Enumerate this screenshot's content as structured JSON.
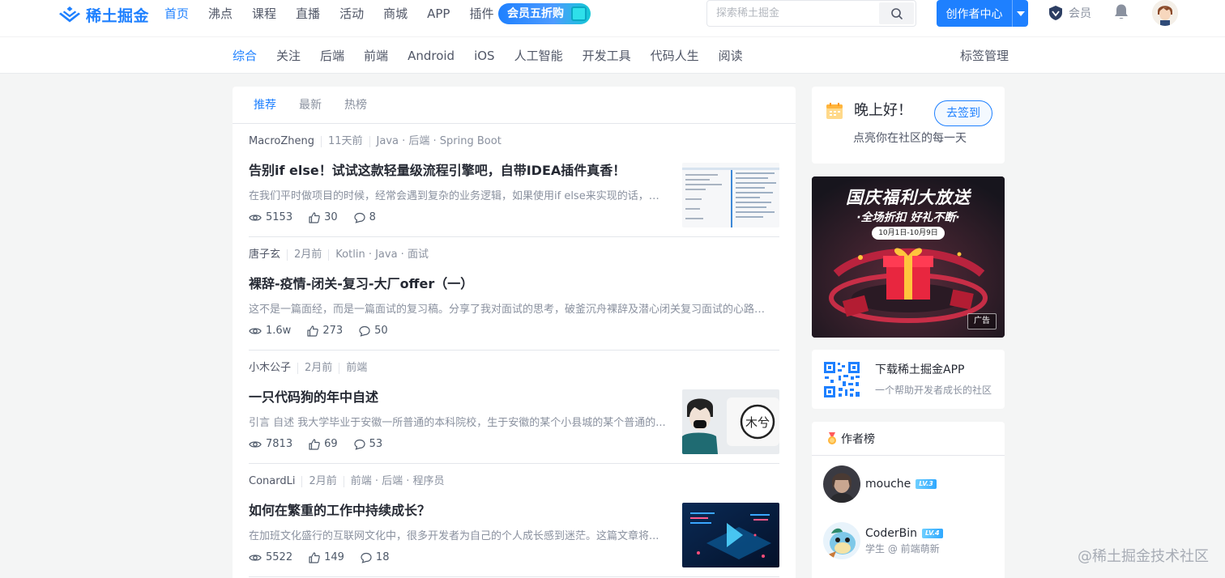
{
  "brand": {
    "name": "稀土掘金",
    "color": "#1e80ff"
  },
  "main_nav": [
    {
      "label": "首页",
      "active": true
    },
    {
      "label": "沸点"
    },
    {
      "label": "课程"
    },
    {
      "label": "直播"
    },
    {
      "label": "活动"
    },
    {
      "label": "商城"
    },
    {
      "label": "APP"
    },
    {
      "label": "插件"
    }
  ],
  "vip_badge": "会员五折购",
  "search": {
    "placeholder": "探索稀土掘金",
    "icon": "search-icon"
  },
  "creator_button": "创作者中心",
  "member_link": "会员",
  "categories": [
    {
      "label": "综合",
      "active": true
    },
    {
      "label": "关注"
    },
    {
      "label": "后端"
    },
    {
      "label": "前端"
    },
    {
      "label": "Android"
    },
    {
      "label": "iOS"
    },
    {
      "label": "人工智能"
    },
    {
      "label": "开发工具"
    },
    {
      "label": "代码人生"
    },
    {
      "label": "阅读"
    }
  ],
  "tag_manage": "标签管理",
  "feed_tabs": [
    {
      "label": "推荐",
      "active": true
    },
    {
      "label": "最新"
    },
    {
      "label": "热榜"
    }
  ],
  "articles": [
    {
      "author": "MacroZheng",
      "time": "11天前",
      "tags": "Java · 后端 · Spring Boot",
      "title": "告别if else！试试这款轻量级流程引擎吧，自带IDEA插件真香！",
      "abstract": "在我们平时做项目的时候，经常会遇到复杂的业务逻辑，如果使用if else来实现的话，往...",
      "views": "5153",
      "likes": "30",
      "comments": "8",
      "has_thumb": true
    },
    {
      "author": "唐子玄",
      "time": "2月前",
      "tags": "Kotlin · Java · 面试",
      "title": "裸辞-疫情-闭关-复习-大厂offer（一）",
      "abstract": "这不是一篇面经，而是一篇面试的复习稿。分享了我对面试的思考，破釜沉舟裸辞及潜心闭关复习面试的心路历...",
      "views": "1.6w",
      "likes": "273",
      "comments": "50",
      "has_thumb": false
    },
    {
      "author": "小木公子",
      "time": "2月前",
      "tags": "前端",
      "title": "一只代码狗的年中自述",
      "abstract": "引言 自述 我大学毕业于安徽一所普通的本科院校，生于安徽的某个小县城的某个普通的...",
      "views": "7813",
      "likes": "69",
      "comments": "53",
      "has_thumb": true
    },
    {
      "author": "ConardLi",
      "time": "2月前",
      "tags": "前端 · 后端 · 程序员",
      "title": "如何在繁重的工作中持续成长？",
      "abstract": "在加班文化盛行的互联网文化中，很多开发者为自己的个人成长感到迷茫。这篇文章将...",
      "views": "5522",
      "likes": "149",
      "comments": "18",
      "has_thumb": true
    }
  ],
  "signin": {
    "greeting": "晚上好！",
    "subtitle": "点亮你在社区的每一天",
    "button": "去签到"
  },
  "ad": {
    "title": "国庆福利大放送",
    "subtitle": "·全场折扣 好礼不断·",
    "date": "10月1日-10月9日",
    "label": "广告"
  },
  "app_card": {
    "title": "下载稀土掘金APP",
    "subtitle": "一个帮助开发者成长的社区"
  },
  "author_rank": {
    "title": "作者榜",
    "items": [
      {
        "name": "mouche",
        "level": "LV.3",
        "desc": ""
      },
      {
        "name": "CoderBin",
        "level": "LV.4",
        "desc": "学生 @ 前端萌新"
      }
    ]
  },
  "watermark": "@稀土掘金技术社区"
}
